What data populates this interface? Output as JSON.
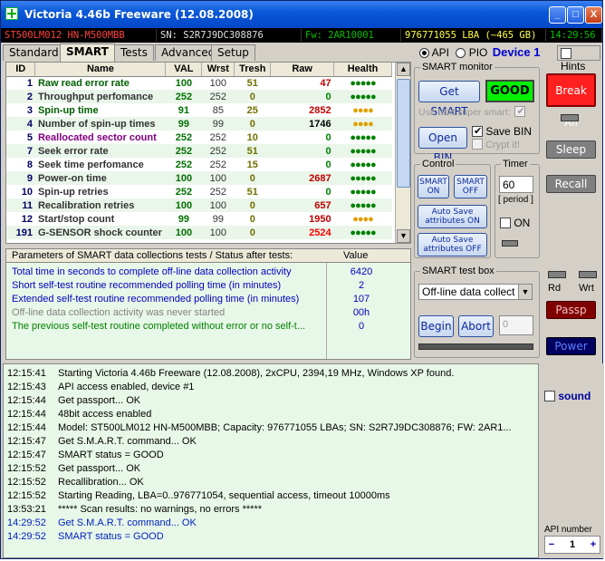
{
  "window": {
    "title": "Victoria 4.46b Freeware (12.08.2008)",
    "minimize": "_",
    "maximize": "□",
    "close": "X"
  },
  "infobar": {
    "model": "ST500LM012 HN-M500MBB",
    "serial": "SN: S2R7J9DC308876",
    "firmware": "Fw: 2AR10001",
    "capacity": "976771055 LBA (~465 GB)",
    "time": "14:29:56"
  },
  "tabs": [
    "Standard",
    "SMART",
    "Tests",
    "Advanced",
    "Setup"
  ],
  "mode": {
    "api_label": "API",
    "pio_label": "PIO",
    "device_label": "Device 1",
    "hints_label": "Hints"
  },
  "table": {
    "headers": [
      "ID",
      "Name",
      "VAL",
      "Wrst",
      "Tresh",
      "Raw",
      "Health"
    ],
    "rows": [
      {
        "id": "1",
        "name": "Raw read error rate",
        "val": "100",
        "wrst": "100",
        "tresh": "51",
        "raw": "47",
        "health": "●●●●●",
        "nameColor": "#006000",
        "rawColor": "#c00000",
        "healthColor": "#008000"
      },
      {
        "id": "2",
        "name": "Throughput perfomance",
        "val": "252",
        "wrst": "252",
        "tresh": "0",
        "raw": "0",
        "health": "●●●●●",
        "nameColor": "#333333",
        "rawColor": "#008000",
        "healthColor": "#008000"
      },
      {
        "id": "3",
        "name": "Spin-up time",
        "val": "91",
        "wrst": "85",
        "tresh": "25",
        "raw": "2852",
        "health": "●●●●",
        "nameColor": "#006000",
        "rawColor": "#c00000",
        "healthColor": "#e0a000"
      },
      {
        "id": "4",
        "name": "Number of spin-up times",
        "val": "99",
        "wrst": "99",
        "tresh": "0",
        "raw": "1746",
        "health": "●●●●",
        "nameColor": "#333333",
        "rawColor": "#000000",
        "healthColor": "#e0a000"
      },
      {
        "id": "5",
        "name": "Reallocated sector count",
        "val": "252",
        "wrst": "252",
        "tresh": "10",
        "raw": "0",
        "health": "●●●●●",
        "nameColor": "#800080",
        "rawColor": "#008000",
        "healthColor": "#008000"
      },
      {
        "id": "7",
        "name": "Seek error rate",
        "val": "252",
        "wrst": "252",
        "tresh": "51",
        "raw": "0",
        "health": "●●●●●",
        "nameColor": "#333333",
        "rawColor": "#008000",
        "healthColor": "#008000"
      },
      {
        "id": "8",
        "name": "Seek time perfomance",
        "val": "252",
        "wrst": "252",
        "tresh": "15",
        "raw": "0",
        "health": "●●●●●",
        "nameColor": "#333333",
        "rawColor": "#008000",
        "healthColor": "#008000"
      },
      {
        "id": "9",
        "name": "Power-on time",
        "val": "100",
        "wrst": "100",
        "tresh": "0",
        "raw": "2687",
        "health": "●●●●●",
        "nameColor": "#333333",
        "rawColor": "#c00000",
        "healthColor": "#008000"
      },
      {
        "id": "10",
        "name": "Spin-up retries",
        "val": "252",
        "wrst": "252",
        "tresh": "51",
        "raw": "0",
        "health": "●●●●●",
        "nameColor": "#333333",
        "rawColor": "#008000",
        "healthColor": "#008000"
      },
      {
        "id": "11",
        "name": "Recalibration retries",
        "val": "100",
        "wrst": "100",
        "tresh": "0",
        "raw": "657",
        "health": "●●●●●",
        "nameColor": "#333333",
        "rawColor": "#c00000",
        "healthColor": "#008000"
      },
      {
        "id": "12",
        "name": "Start/stop count",
        "val": "99",
        "wrst": "99",
        "tresh": "0",
        "raw": "1950",
        "health": "●●●●",
        "nameColor": "#333333",
        "rawColor": "#c00000",
        "healthColor": "#e0a000"
      },
      {
        "id": "191",
        "name": "G-SENSOR shock counter",
        "val": "100",
        "wrst": "100",
        "tresh": "0",
        "raw": "2524",
        "health": "●●●●●",
        "nameColor": "#333333",
        "rawColor": "#ff0000",
        "healthColor": "#008000"
      }
    ]
  },
  "params": {
    "header_label": "Parameters of SMART data collections tests / Status after tests:",
    "header_value": "Value",
    "rows": [
      {
        "label": "Total time in seconds to complete off-line data collection activity",
        "value": "6420",
        "color": "#0000c0"
      },
      {
        "label": "Short self-test routine recommended polling time (in minutes)",
        "value": "2",
        "color": "#0000c0"
      },
      {
        "label": "Extended self-test routine recommended polling time (in minutes)",
        "value": "107",
        "color": "#0000c0"
      },
      {
        "label": "Off-line data collection activity was never started",
        "value": "00h",
        "color": "#808080"
      },
      {
        "label": "The previous self-test routine completed without error or no self-t...",
        "value": "0",
        "color": "#008000"
      }
    ]
  },
  "smart_monitor": {
    "title": "SMART monitor",
    "get_smart": "Get SMART",
    "status": "GOOD",
    "ibm_label": "Use IBM super smart:",
    "open_bin": "Open BIN",
    "save_bin": "Save BIN",
    "crypt": "Crypt it!"
  },
  "control": {
    "title": "Control",
    "smart_on": "SMART ON",
    "smart_off": "SMART OFF",
    "autosave_on": "Auto Save attributes ON",
    "autosave_off": "Auto Save attributes OFF"
  },
  "timer": {
    "title": "Timer",
    "value": "60",
    "period": "[ period ]",
    "on_label": "ON"
  },
  "test_box": {
    "title": "SMART test box",
    "selected": "Off-line data collect",
    "begin": "Begin",
    "abort": "Abort",
    "field": "0"
  },
  "right_buttons": {
    "break_all": "Break All",
    "sleep": "Sleep",
    "recall": "Recall",
    "rd": "Rd",
    "wrt": "Wrt",
    "passp": "Passp",
    "power": "Power"
  },
  "sound_label": "sound",
  "api_number": {
    "label": "API number",
    "minus": "−",
    "value": "1",
    "plus": "+"
  },
  "log": [
    {
      "time": "12:15:41",
      "text": "Starting Victoria 4.46b Freeware (12.08.2008), 2xCPU, 2394,19 MHz, Windows XP found.",
      "blue": false
    },
    {
      "time": "12:15:43",
      "text": "API access enabled, device #1",
      "blue": false
    },
    {
      "time": "12:15:44",
      "text": "Get passport... OK",
      "blue": false
    },
    {
      "time": "12:15:44",
      "text": "48bit access enabled",
      "blue": false
    },
    {
      "time": "12:15:44",
      "text": "Model: ST500LM012 HN-M500MBB; Capacity: 976771055 LBAs; SN: S2R7J9DC308876; FW: 2AR1...",
      "blue": false
    },
    {
      "time": "12:15:47",
      "text": "Get S.M.A.R.T. command... OK",
      "blue": false
    },
    {
      "time": "12:15:47",
      "text": "SMART status = GOOD",
      "blue": false
    },
    {
      "time": "12:15:52",
      "text": "Get passport... OK",
      "blue": false
    },
    {
      "time": "12:15:52",
      "text": "Recallibration... OK",
      "blue": false
    },
    {
      "time": "12:15:52",
      "text": "Starting Reading, LBA=0..976771054, sequential access, timeout 10000ms",
      "blue": false
    },
    {
      "time": "13:53:21",
      "text": "***** Scan results: no warnings, no errors *****",
      "blue": false
    },
    {
      "time": "14:29:52",
      "text": "Get S.M.A.R.T. command... OK",
      "blue": true
    },
    {
      "time": "14:29:52",
      "text": "SMART status = GOOD",
      "blue": true
    }
  ]
}
